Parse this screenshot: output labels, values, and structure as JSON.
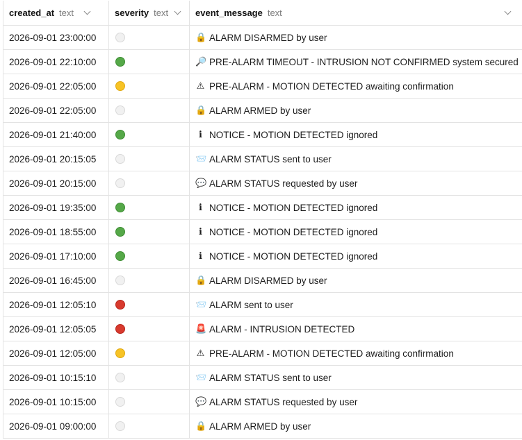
{
  "columns": [
    {
      "name": "created_at",
      "type": "text"
    },
    {
      "name": "severity",
      "type": "text"
    },
    {
      "name": "event_message",
      "type": "text"
    }
  ],
  "severity_colors": {
    "white": "#f1f1f1",
    "green": "#55a848",
    "yellow": "#f7c325",
    "red": "#d83a2e"
  },
  "rows": [
    {
      "created_at": "2026-09-01 23:00:00",
      "severity": "white",
      "icon": "lock-icon",
      "glyph": "🔒",
      "message": "ALARM DISARMED by user"
    },
    {
      "created_at": "2026-09-01 22:10:00",
      "severity": "green",
      "icon": "magnifier-icon",
      "glyph": "🔎",
      "message": "PRE-ALARM TIMEOUT - INTRUSION NOT CONFIRMED system secured"
    },
    {
      "created_at": "2026-09-01 22:05:00",
      "severity": "yellow",
      "icon": "warning-icon",
      "glyph": "⚠",
      "message": "PRE-ALARM - MOTION DETECTED awaiting confirmation"
    },
    {
      "created_at": "2026-09-01 22:05:00",
      "severity": "white",
      "icon": "lock-icon",
      "glyph": "🔒",
      "message": "ALARM ARMED by user"
    },
    {
      "created_at": "2026-09-01 21:40:00",
      "severity": "green",
      "icon": "info-icon",
      "glyph": "ℹ",
      "message": "NOTICE - MOTION DETECTED ignored"
    },
    {
      "created_at": "2026-09-01 20:15:05",
      "severity": "white",
      "icon": "envelope-icon",
      "glyph": "📨",
      "message": "ALARM STATUS sent to user"
    },
    {
      "created_at": "2026-09-01 20:15:00",
      "severity": "white",
      "icon": "speech-bubble-icon",
      "glyph": "💬",
      "message": "ALARM STATUS requested by user"
    },
    {
      "created_at": "2026-09-01 19:35:00",
      "severity": "green",
      "icon": "info-icon",
      "glyph": "ℹ",
      "message": "NOTICE - MOTION DETECTED ignored"
    },
    {
      "created_at": "2026-09-01 18:55:00",
      "severity": "green",
      "icon": "info-icon",
      "glyph": "ℹ",
      "message": "NOTICE - MOTION DETECTED ignored"
    },
    {
      "created_at": "2026-09-01 17:10:00",
      "severity": "green",
      "icon": "info-icon",
      "glyph": "ℹ",
      "message": "NOTICE - MOTION DETECTED ignored"
    },
    {
      "created_at": "2026-09-01 16:45:00",
      "severity": "white",
      "icon": "lock-icon",
      "glyph": "🔒",
      "message": "ALARM DISARMED by user"
    },
    {
      "created_at": "2026-09-01 12:05:10",
      "severity": "red",
      "icon": "envelope-icon",
      "glyph": "📨",
      "message": "ALARM sent to user"
    },
    {
      "created_at": "2026-09-01 12:05:05",
      "severity": "red",
      "icon": "siren-icon",
      "glyph": "🚨",
      "message": "ALARM - INTRUSION DETECTED"
    },
    {
      "created_at": "2026-09-01 12:05:00",
      "severity": "yellow",
      "icon": "warning-icon",
      "glyph": "⚠",
      "message": "PRE-ALARM - MOTION DETECTED awaiting confirmation"
    },
    {
      "created_at": "2026-09-01 10:15:10",
      "severity": "white",
      "icon": "envelope-icon",
      "glyph": "📨",
      "message": "ALARM STATUS sent to user"
    },
    {
      "created_at": "2026-09-01 10:15:00",
      "severity": "white",
      "icon": "speech-bubble-icon",
      "glyph": "💬",
      "message": "ALARM STATUS requested by user"
    },
    {
      "created_at": "2026-09-01 09:00:00",
      "severity": "white",
      "icon": "lock-icon",
      "glyph": "🔒",
      "message": "ALARM ARMED by user"
    }
  ]
}
